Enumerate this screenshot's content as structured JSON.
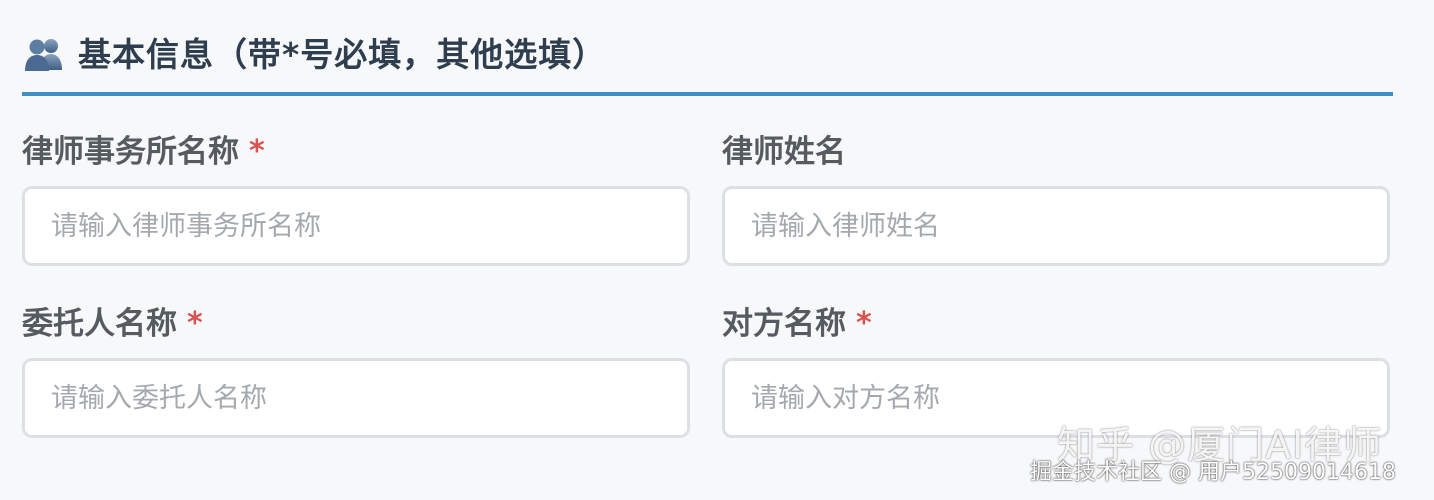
{
  "section": {
    "icon": "users-icon",
    "title": "基本信息（带*号必填，其他选填）",
    "accent_color": "#3d8fc4"
  },
  "fields": [
    {
      "label": "律师事务所名称",
      "required": "*",
      "placeholder": "请输入律师事务所名称",
      "value": ""
    },
    {
      "label": "律师姓名",
      "required": "",
      "placeholder": "请输入律师姓名",
      "value": ""
    },
    {
      "label": "委托人名称",
      "required": "*",
      "placeholder": "请输入委托人名称",
      "value": ""
    },
    {
      "label": "对方名称",
      "required": "*",
      "placeholder": "请输入对方名称",
      "value": ""
    }
  ],
  "required_color": "#d9534f",
  "watermarks": {
    "zhihu": "知乎 @厦门AI律师",
    "juejin": "掘金技术社区 @ 用户52509014618"
  }
}
